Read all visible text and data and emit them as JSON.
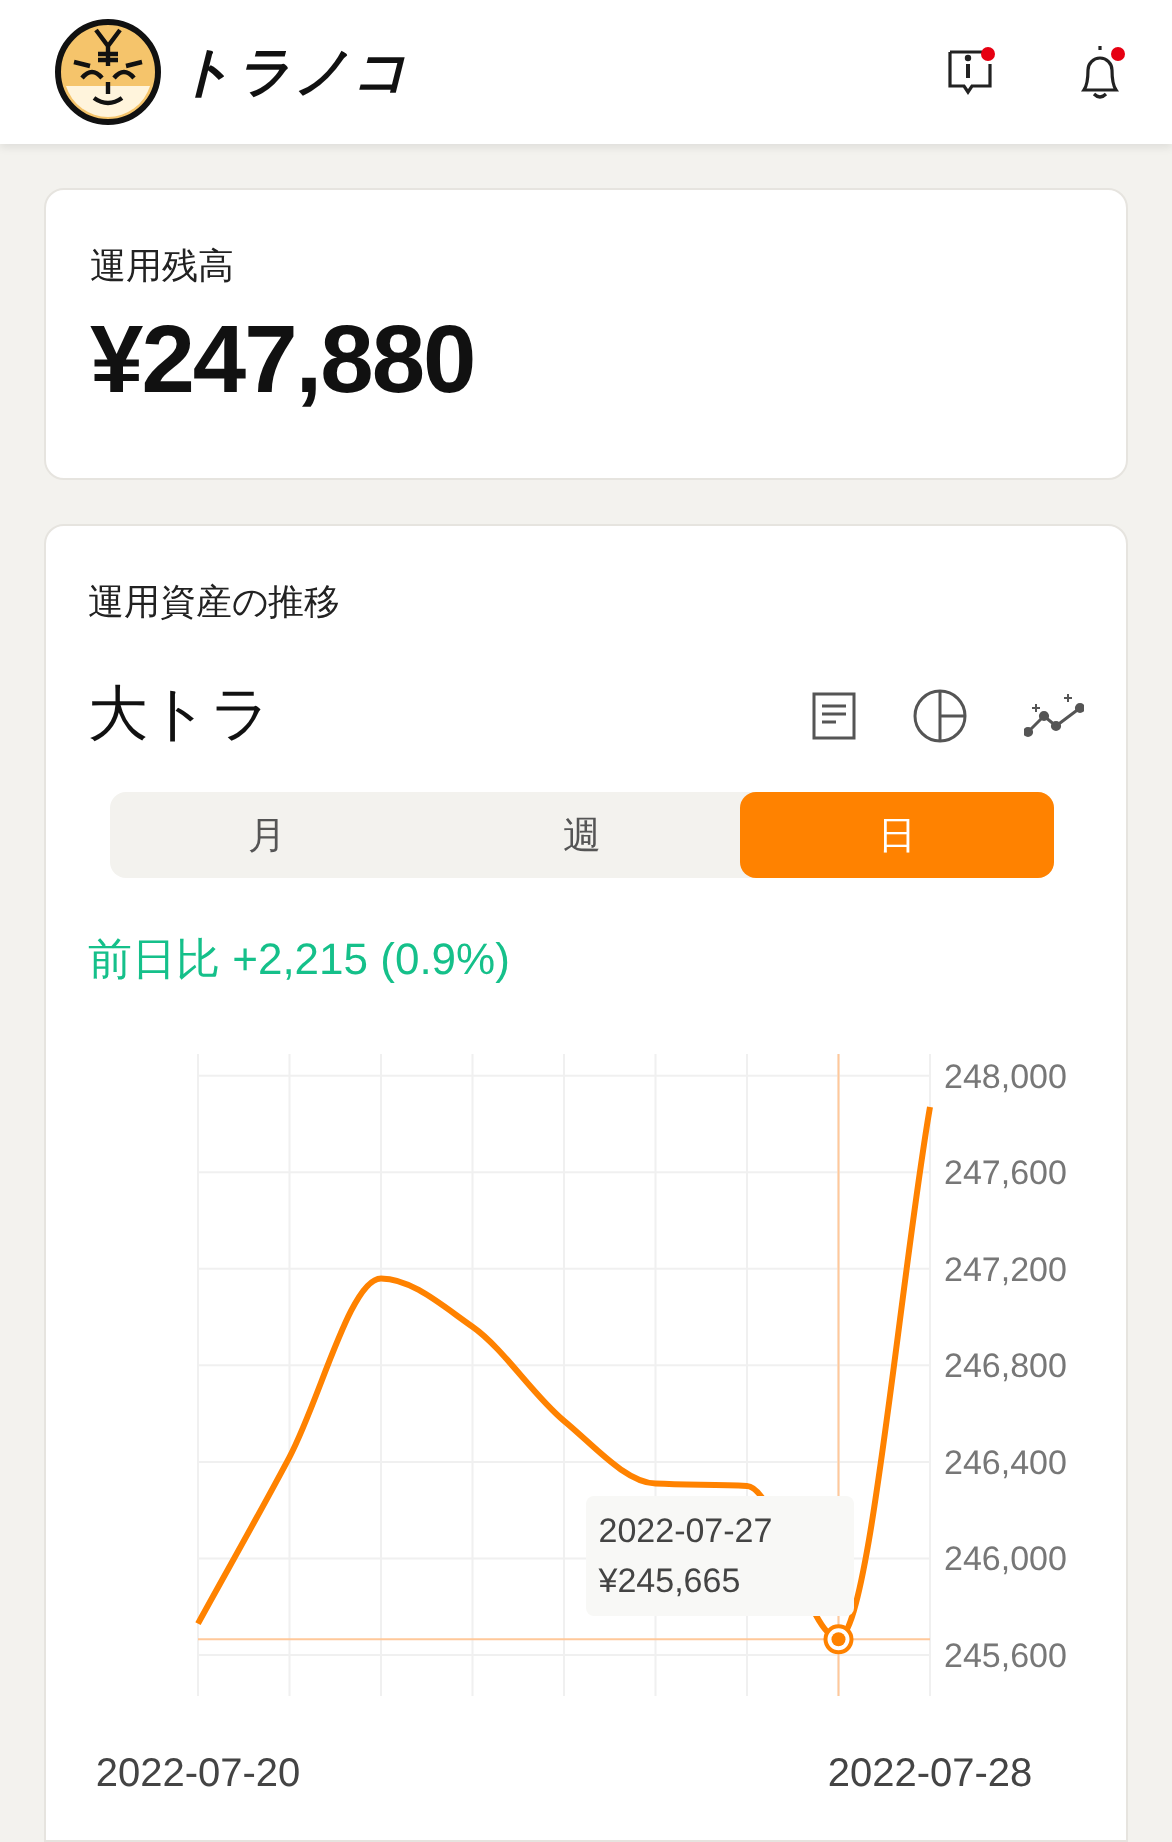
{
  "header": {
    "app_name": "トラノコ",
    "notifications": {
      "info_unread": true,
      "bell_unread": true
    }
  },
  "balance": {
    "label": "運用残高",
    "amount": "¥247,880"
  },
  "assets": {
    "title": "運用資産の推移",
    "fund": "大トラ",
    "tabs": [
      {
        "label": "月",
        "selected": false
      },
      {
        "label": "週",
        "selected": false
      },
      {
        "label": "日",
        "selected": true
      }
    ],
    "change": "前日比 +2,215 (0.9%)",
    "chart_data": {
      "type": "line",
      "x": [
        "2022-07-20",
        "2022-07-21",
        "2022-07-22",
        "2022-07-23",
        "2022-07-24",
        "2022-07-25",
        "2022-07-26",
        "2022-07-27",
        "2022-07-28"
      ],
      "series": [
        {
          "color": "#ff8200",
          "values": [
            245730,
            246420,
            247160,
            246960,
            246570,
            246310,
            246300,
            245670,
            247870
          ]
        }
      ],
      "xlim": [
        "2022-07-20",
        "2022-07-28"
      ],
      "ylim": [
        245430,
        248090
      ],
      "grid": true,
      "yticks": [
        {
          "value": 248000,
          "label": "248,000"
        },
        {
          "value": 247600,
          "label": "247,600"
        },
        {
          "value": 247200,
          "label": "247,200"
        },
        {
          "value": 246800,
          "label": "246,800"
        },
        {
          "value": 246400,
          "label": "246,400"
        },
        {
          "value": 246000,
          "label": "246,000"
        },
        {
          "value": 245600,
          "label": "245,600"
        }
      ],
      "xticks": [
        {
          "value": "2022-07-20",
          "label": "2022-07-20"
        },
        {
          "value": "2022-07-28",
          "label": "2022-07-28"
        }
      ],
      "ref_lines": [
        {
          "axis": "x",
          "value": "2022-07-27",
          "color": "#ffc89a"
        },
        {
          "axis": "y",
          "value": 245665,
          "color": "#ffc89a"
        }
      ],
      "annotations": [
        {
          "x": "2022-07-27",
          "y": 245665,
          "text": "2022-07-27\n¥245,665"
        }
      ]
    }
  }
}
